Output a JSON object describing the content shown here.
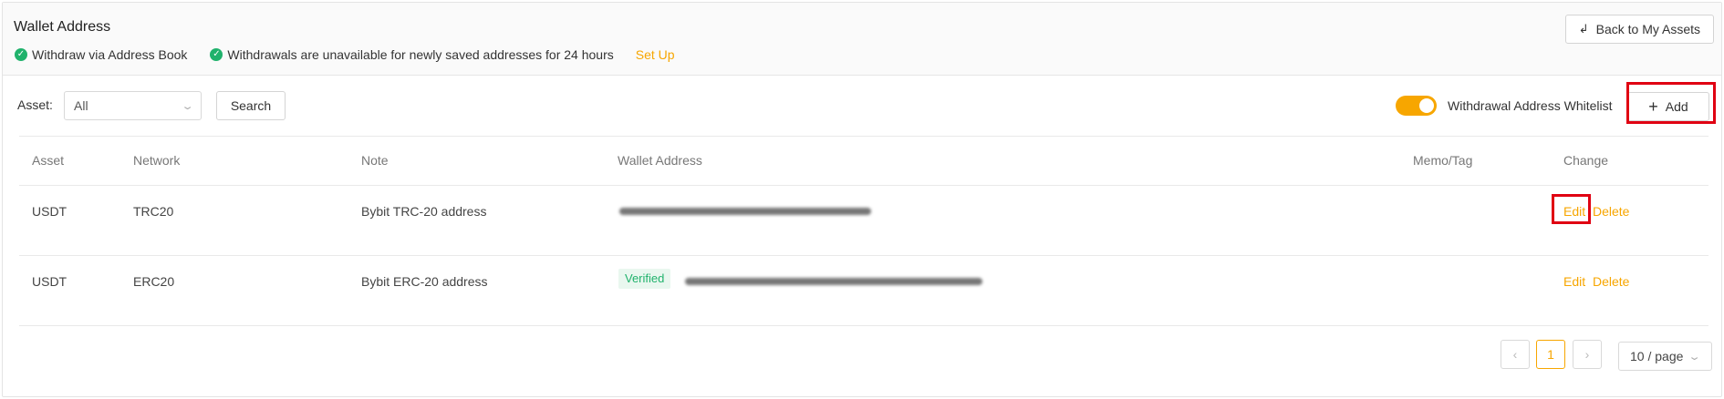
{
  "header": {
    "title": "Wallet Address",
    "notices": [
      {
        "icon": "check-circle-icon",
        "text": "Withdraw via Address Book"
      },
      {
        "icon": "check-circle-icon",
        "text": "Withdrawals are unavailable for newly saved addresses for 24 hours"
      }
    ],
    "setup_link": "Set Up",
    "back_button": "Back to My Assets"
  },
  "filters": {
    "asset_label": "Asset:",
    "asset_value": "All",
    "search_button": "Search"
  },
  "whitelist": {
    "label": "Withdrawal Address Whitelist",
    "enabled": true
  },
  "add_button": "Add",
  "table": {
    "columns": [
      "Asset",
      "Network",
      "Note",
      "Wallet Address",
      "Memo/Tag",
      "Change"
    ],
    "rows": [
      {
        "asset": "USDT",
        "network": "TRC20",
        "note": "Bybit TRC-20 address",
        "verified": "",
        "memo": "",
        "edit": "Edit",
        "delete": "Delete"
      },
      {
        "asset": "USDT",
        "network": "ERC20",
        "note": "Bybit ERC-20 address",
        "verified": "Verified",
        "memo": "",
        "edit": "Edit",
        "delete": "Delete"
      }
    ]
  },
  "pagination": {
    "current_page": "1",
    "page_size": "10 / page"
  },
  "colors": {
    "accent": "#f7a600",
    "success": "#20b26c",
    "highlight": "#e00012"
  }
}
